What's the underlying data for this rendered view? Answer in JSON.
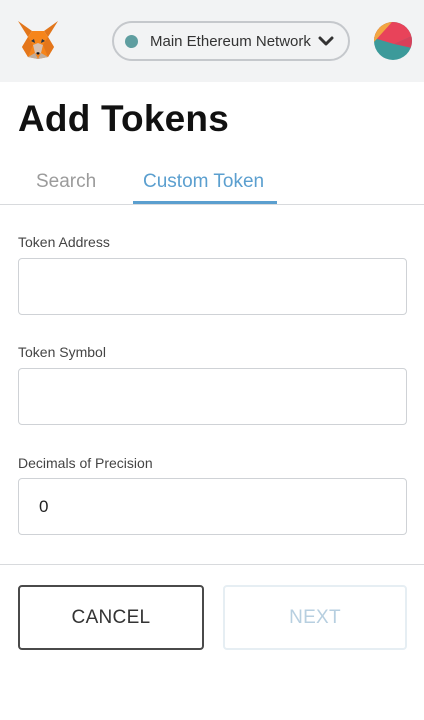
{
  "header": {
    "network_label": "Main Ethereum Network",
    "network_dot_color": "#5f9ea0",
    "logo_icon": "metamask-fox-icon",
    "avatar_icon": "account-identicon"
  },
  "page": {
    "title": "Add Tokens"
  },
  "tabs": [
    {
      "label": "Search",
      "active": false
    },
    {
      "label": "Custom Token",
      "active": true
    }
  ],
  "form": {
    "address_label": "Token Address",
    "address_value": "",
    "symbol_label": "Token Symbol",
    "symbol_value": "",
    "decimals_label": "Decimals of Precision",
    "decimals_value": "0"
  },
  "actions": {
    "cancel_label": "CANCEL",
    "next_label": "NEXT",
    "next_enabled": false
  },
  "colors": {
    "accent": "#5b9fcf",
    "header_bg": "#f2f3f4"
  }
}
